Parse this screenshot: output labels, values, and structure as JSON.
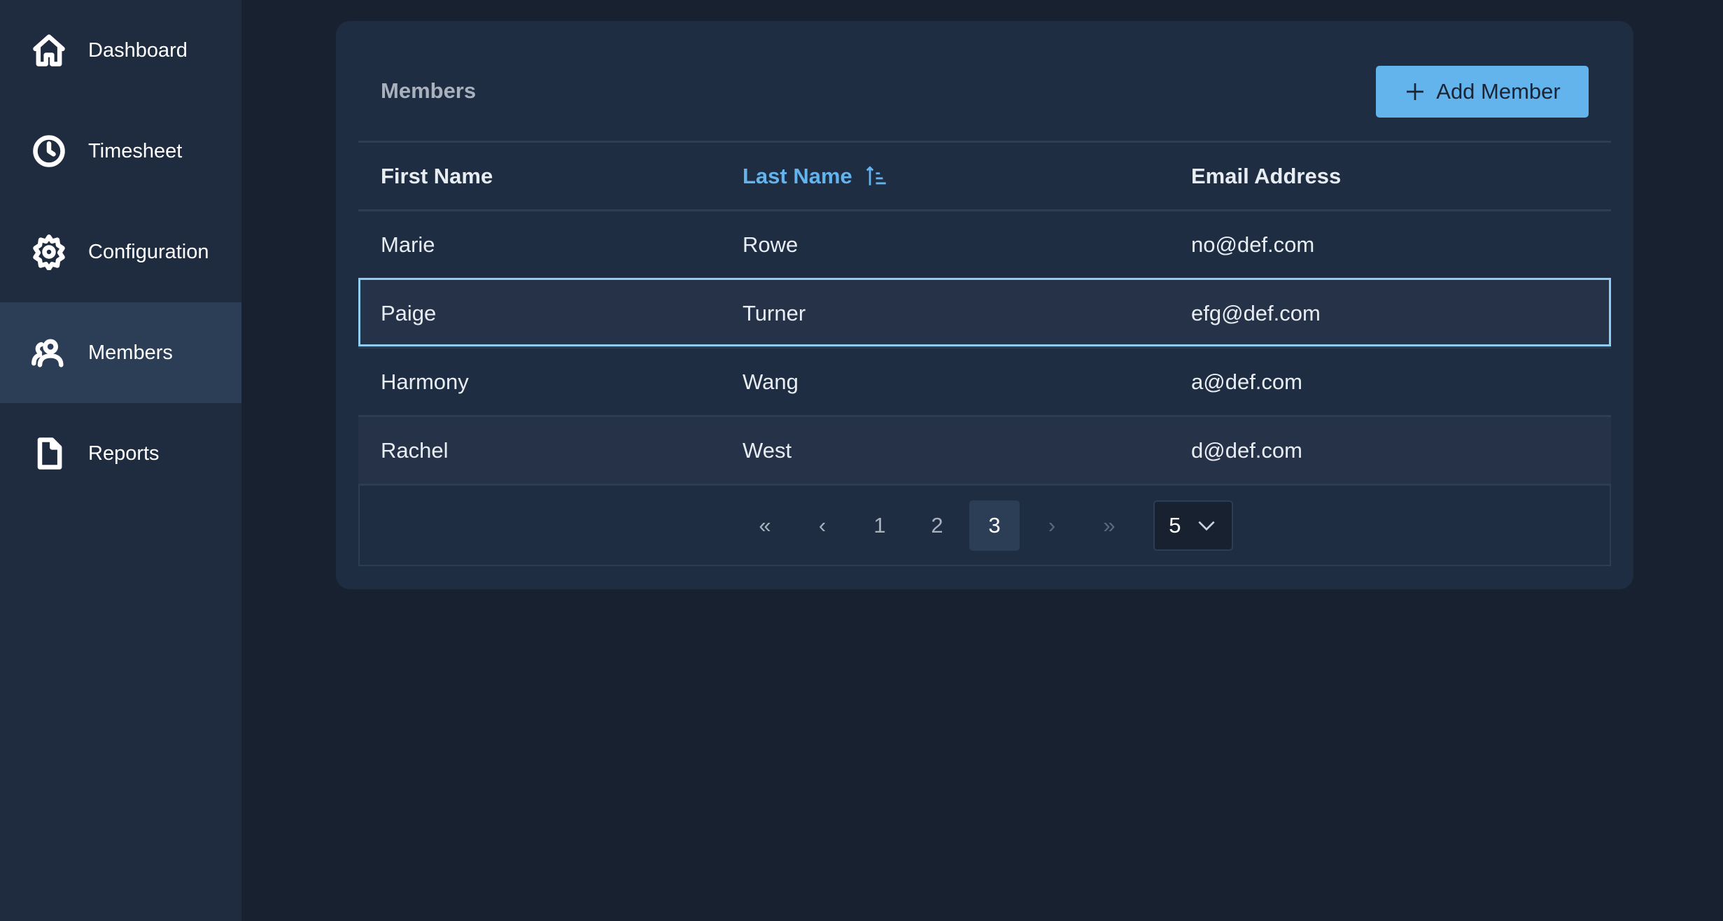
{
  "sidebar": {
    "items": [
      {
        "label": "Dashboard",
        "icon": "home-icon"
      },
      {
        "label": "Timesheet",
        "icon": "clock-icon"
      },
      {
        "label": "Configuration",
        "icon": "gear-icon"
      },
      {
        "label": "Members",
        "icon": "users-icon",
        "active": true
      },
      {
        "label": "Reports",
        "icon": "file-icon"
      }
    ]
  },
  "card": {
    "title": "Members",
    "add_label": "Add Member"
  },
  "table": {
    "headers": [
      "First Name",
      "Last Name",
      "Email Address"
    ],
    "sort": {
      "column": "Last Name",
      "direction": "ascending"
    },
    "rows": [
      [
        "Marie",
        "Rowe",
        "no@def.com"
      ],
      [
        "Paige",
        "Turner",
        "efg@def.com"
      ],
      [
        "Harmony",
        "Wang",
        "a@def.com"
      ],
      [
        "Rachel",
        "West",
        "d@def.com"
      ]
    ],
    "selected_row": 1
  },
  "pagination": {
    "first": "«",
    "prev": "‹",
    "pages": [
      "1",
      "2",
      "3"
    ],
    "current": "3",
    "next": "›",
    "last": "»",
    "page_size": "5"
  },
  "colors": {
    "accent": "#63b3ed",
    "selection": "#90cdf4"
  }
}
